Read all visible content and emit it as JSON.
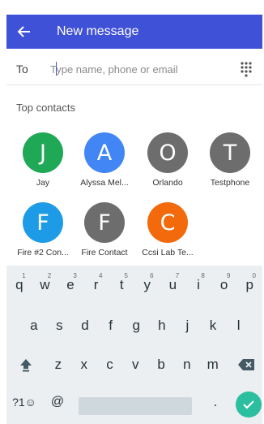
{
  "appbar": {
    "title": "New message",
    "back_icon": "arrow-left-icon",
    "color": "#3f51d6"
  },
  "to_field": {
    "label": "To",
    "placeholder": "Type name, phone or email",
    "value": "",
    "dialpad_icon": "dialpad-icon"
  },
  "top_contacts": {
    "title": "Top contacts",
    "items": [
      {
        "initial": "J",
        "name": "Jay",
        "color": "#1fa855"
      },
      {
        "initial": "A",
        "name": "Alyssa Mel...",
        "color": "#4285f4"
      },
      {
        "initial": "O",
        "name": "Orlando",
        "color": "#6d6d6d"
      },
      {
        "initial": "T",
        "name": "Testphone",
        "color": "#6d6d6d"
      },
      {
        "initial": "F",
        "name": "Fire #2 Con...",
        "color": "#1e9be6"
      },
      {
        "initial": "F",
        "name": "Fire Contact",
        "color": "#6d6d6d"
      },
      {
        "initial": "C",
        "name": "Ccsi Lab Te...",
        "color": "#f26a0c"
      }
    ]
  },
  "keyboard": {
    "row1": [
      {
        "k": "q",
        "h": "1"
      },
      {
        "k": "w",
        "h": "2"
      },
      {
        "k": "e",
        "h": "3"
      },
      {
        "k": "r",
        "h": "4"
      },
      {
        "k": "t",
        "h": "5"
      },
      {
        "k": "y",
        "h": "6"
      },
      {
        "k": "u",
        "h": "7"
      },
      {
        "k": "i",
        "h": "8"
      },
      {
        "k": "o",
        "h": "9"
      },
      {
        "k": "p",
        "h": "0"
      }
    ],
    "row2": [
      "a",
      "s",
      "d",
      "f",
      "g",
      "h",
      "j",
      "k",
      "l"
    ],
    "row3": [
      "z",
      "x",
      "c",
      "v",
      "b",
      "n",
      "m"
    ],
    "symbols_label": "?1☺",
    "at_label": "@",
    "period_label": ".",
    "shift_icon": "shift-icon",
    "backspace_icon": "backspace-icon",
    "send_icon": "check-icon",
    "send_color": "#2bbfa0"
  }
}
